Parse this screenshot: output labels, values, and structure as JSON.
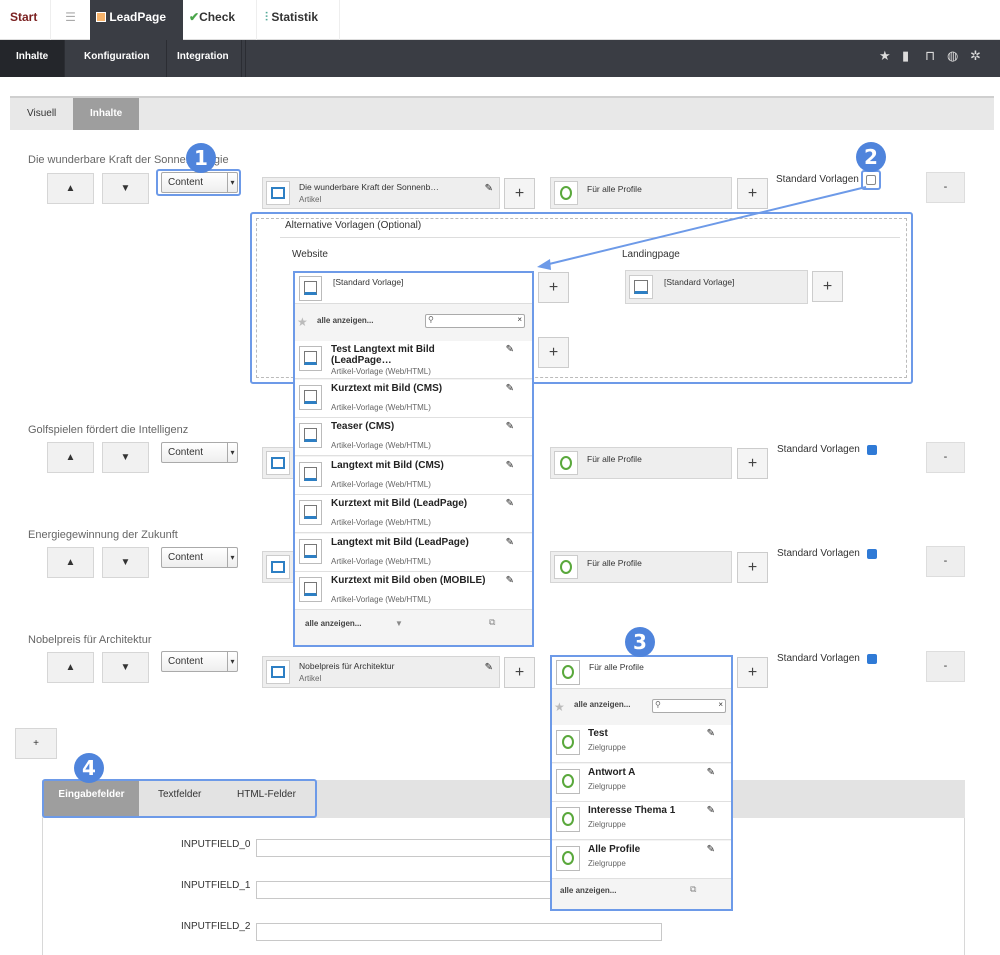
{
  "top_tabs": {
    "start": "Start",
    "list": "☰",
    "leadpage": "LeadPage",
    "check": "Check",
    "statistik": "Statistik"
  },
  "subnav": {
    "inhalte": "Inhalte",
    "konfiguration": "Konfiguration",
    "integration": "Integration"
  },
  "toolbar_icons": [
    "star-icon",
    "comment-icon",
    "unlock-icon",
    "globe-icon",
    "gear-icon"
  ],
  "view_tabs": {
    "visuell": "Visuell",
    "inhalte": "Inhalte"
  },
  "rows": [
    {
      "title": "Die wunderbare Kraft der Sonnenenergie",
      "select": "Content",
      "article_title": "Die wunderbare Kraft der Sonnenb…",
      "article_sub": "Artikel",
      "profile": "Für alle Profile",
      "std_label": "Standard Vorlagen"
    },
    {
      "title": "Golfspielen fördert die Intelligenz",
      "select": "Content",
      "profile": "Für alle Profile",
      "std_label": "Standard Vorlagen"
    },
    {
      "title": "Energiegewinnung der Zukunft",
      "select": "Content",
      "profile": "Für alle Profile",
      "std_label": "Standard Vorlagen"
    },
    {
      "title": "Nobelpreis für Architektur",
      "select": "Content",
      "article_title": "Nobelpreis für Architektur",
      "article_sub": "Artikel",
      "profile": "Für alle Profile",
      "std_label": "Standard Vorlagen"
    }
  ],
  "alt": {
    "title": "Alternative Vorlagen (Optional)",
    "website": "Website",
    "landingpage": "Landingpage",
    "std_vorlage": "[Standard Vorlage]"
  },
  "template_dropdown": {
    "show_all": "alle anzeigen...",
    "items": [
      {
        "title": "Test Langtext mit Bild (LeadPage…",
        "sub": "Artikel-Vorlage (Web/HTML)"
      },
      {
        "title": "Kurztext mit Bild (CMS)",
        "sub": "Artikel-Vorlage (Web/HTML)"
      },
      {
        "title": "Teaser (CMS)",
        "sub": "Artikel-Vorlage (Web/HTML)"
      },
      {
        "title": "Langtext mit Bild (CMS)",
        "sub": "Artikel-Vorlage (Web/HTML)"
      },
      {
        "title": "Kurztext mit Bild (LeadPage)",
        "sub": "Artikel-Vorlage (Web/HTML)"
      },
      {
        "title": "Langtext mit Bild (LeadPage)",
        "sub": "Artikel-Vorlage (Web/HTML)"
      },
      {
        "title": "Kurztext mit Bild oben (MOBILE)",
        "sub": "Artikel-Vorlage (Web/HTML)"
      }
    ],
    "footer": "alle anzeigen..."
  },
  "profile_dropdown": {
    "header": "Für alle Profile",
    "show_all": "alle anzeigen...",
    "items": [
      {
        "title": "Test",
        "sub": "Zielgruppe"
      },
      {
        "title": "Antwort A",
        "sub": "Zielgruppe"
      },
      {
        "title": "Interesse Thema 1",
        "sub": "Zielgruppe"
      },
      {
        "title": "Alle Profile",
        "sub": "Zielgruppe"
      }
    ],
    "footer": "alle anzeigen..."
  },
  "badges": [
    "1",
    "2",
    "3",
    "4"
  ],
  "bottom_tabs": {
    "eingabe": "Eingabefelder",
    "text": "Textfelder",
    "html": "HTML-Felder"
  },
  "fields": [
    "INPUTFIELD_0",
    "INPUTFIELD_1",
    "INPUTFIELD_2"
  ],
  "buttons": {
    "up": "▲",
    "down": "▼",
    "plus": "+",
    "minus": "-",
    "add_row": "+"
  }
}
